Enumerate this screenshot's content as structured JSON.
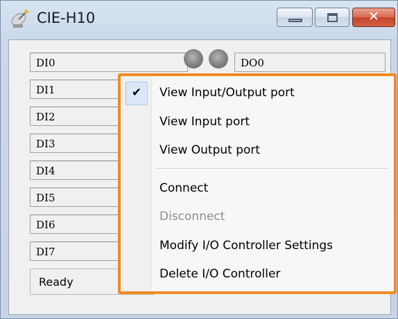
{
  "window": {
    "title": "CIE-H10",
    "icon": "satellite-dish-icon",
    "controls": {
      "minimize_icon": "minimize-icon",
      "maximize_icon": "maximize-icon",
      "close_icon": "close-icon",
      "close_glyph": "✕"
    },
    "accent_close": "#c2462b"
  },
  "inputs": [
    "DI0",
    "DI1",
    "DI2",
    "DI3",
    "DI4",
    "DI5",
    "DI6",
    "DI7"
  ],
  "outputs": [
    "DO0"
  ],
  "status": "Ready",
  "context_menu": {
    "border_color": "#ee8b24",
    "items": [
      {
        "label": "View Input/Output port",
        "checked": true,
        "check_glyph": "✔"
      },
      {
        "label": "View Input port"
      },
      {
        "label": "View Output port"
      },
      {
        "label": "Connect"
      },
      {
        "label": "Disconnect",
        "disabled": true
      },
      {
        "label": "Modify I/O Controller Settings"
      },
      {
        "label": "Delete I/O Controller"
      }
    ]
  }
}
